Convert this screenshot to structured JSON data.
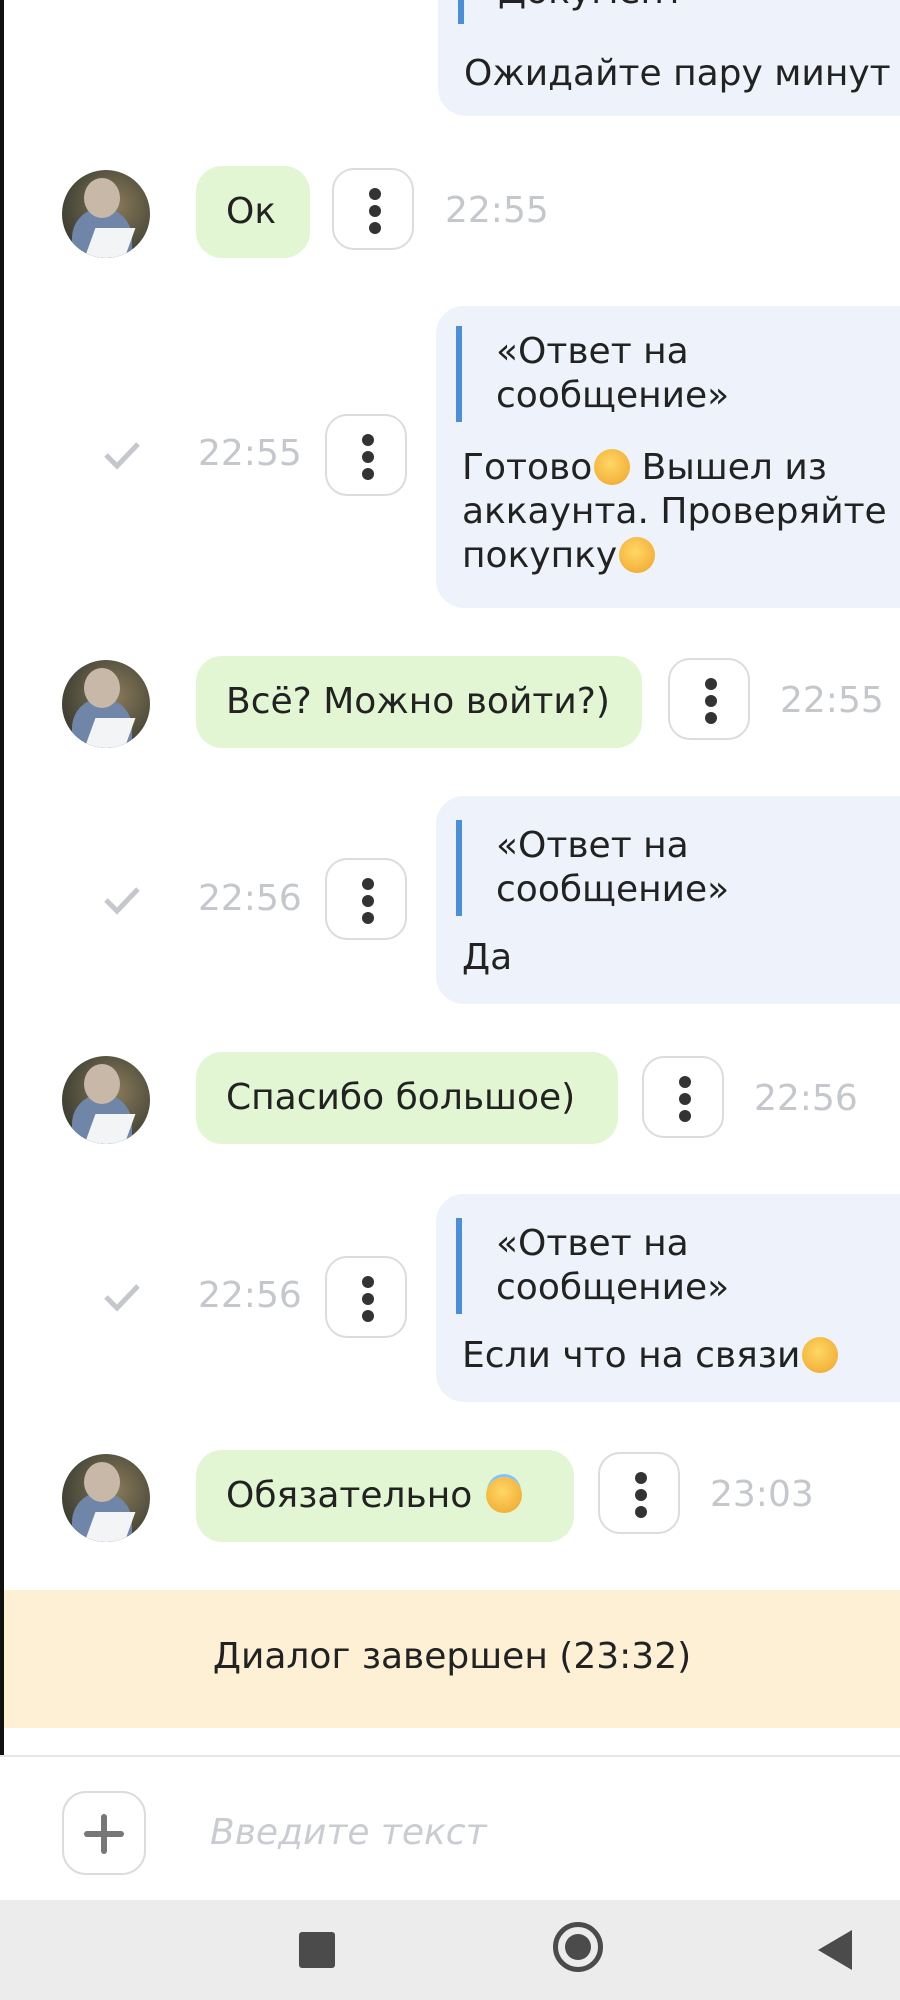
{
  "chat": {
    "messages": [
      {
        "side": "out",
        "quote": "Документ",
        "text": "Ожидайте пару минут"
      },
      {
        "side": "in",
        "text": "Ок",
        "time": "22:55"
      },
      {
        "side": "out",
        "quote": "«Ответ на\nсообщение»",
        "text": "Готово",
        "text2": " Вышел из\nаккаунта. Проверяйте\nпокупку",
        "time": "22:55"
      },
      {
        "side": "in",
        "text": "Всё? Можно войти?)",
        "time": "22:55"
      },
      {
        "side": "out",
        "quote": "«Ответ на\nсообщение»",
        "text": "Да",
        "time": "22:56"
      },
      {
        "side": "in",
        "text": "Спасибо большое)",
        "time": "22:56"
      },
      {
        "side": "out",
        "quote": "«Ответ на\nсообщение»",
        "text": "Если что на связи",
        "time": "22:56"
      },
      {
        "side": "in",
        "text": "Обязательно ",
        "time": "23:03"
      }
    ],
    "emojis": [
      "partying-face-emoji",
      "yum-face-emoji",
      "wink-face-emoji",
      "halo-face-emoji"
    ],
    "banner": "Диалог завершен (23:32)"
  },
  "composer": {
    "placeholder": "Введите текст"
  },
  "colors": {
    "incoming_bubble": "#e2f6d3",
    "outgoing_bubble": "#eef3fb",
    "quote_bar": "#4a8fd8",
    "banner": "#fdf0d5"
  }
}
